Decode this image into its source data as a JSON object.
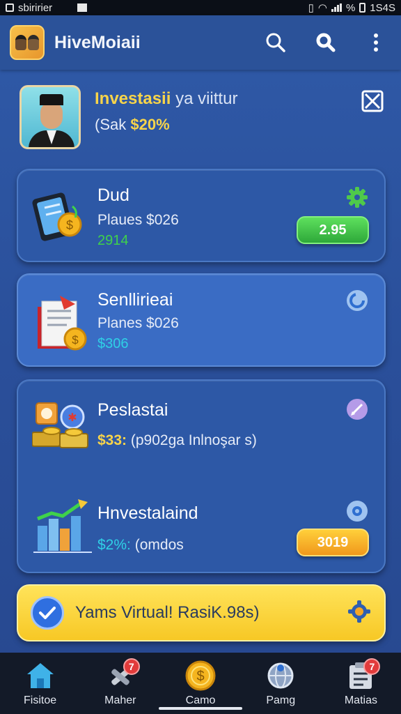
{
  "status_bar": {
    "carrier": "sbiririer",
    "indicators": "%",
    "time": "1S4S"
  },
  "app_bar": {
    "title": "HiveMoiaii",
    "icons": [
      "app-logo",
      "search-icon",
      "search-alt-icon",
      "more-vert-icon"
    ]
  },
  "profile": {
    "title_bold": "Investasii",
    "title_thin": "ya viittur",
    "sub_prefix": "(Sak",
    "sub_value": "$20%"
  },
  "cards": [
    {
      "title": "Dud",
      "line1": "Plaues $026",
      "line2": "2914",
      "line2_color": "green",
      "button": "2.95",
      "button_color": "green",
      "corner_icon": "gear-icon"
    },
    {
      "title": "Senllirieai",
      "line1": "Planes $026",
      "line2": "$306",
      "line2_color": "cyan",
      "corner_icon": "refresh-icon"
    },
    {
      "title": "Peslastai",
      "line1_yellow": "$33:",
      "line1_rest": "(p902ga Inlnoşar s)",
      "corner_icon": "pen-icon"
    },
    {
      "title": "Hnvestalaind",
      "line1_yellow": "$2%:",
      "line1_rest": "(omdos",
      "button": "3019",
      "button_color": "orange",
      "corner_icon": "settings-icon"
    }
  ],
  "banner": {
    "text": "Yams Virtual! RasiK.98s)"
  },
  "bottom_nav": [
    {
      "label": "Fisitoe",
      "icon": "home-icon"
    },
    {
      "label": "Maher",
      "icon": "tools-icon",
      "badge": "7"
    },
    {
      "label": "Camo",
      "icon": "coin-icon"
    },
    {
      "label": "Pamg",
      "icon": "globe-icon"
    },
    {
      "label": "Matias",
      "icon": "clipboard-icon",
      "badge": "7"
    }
  ]
}
